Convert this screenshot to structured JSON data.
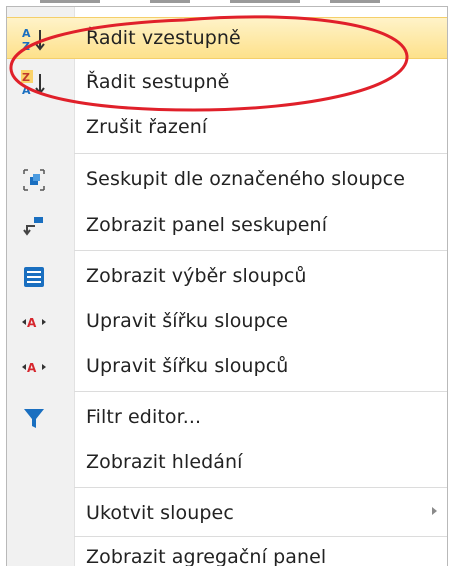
{
  "menu": {
    "items": [
      {
        "label": "Řadit vzestupně",
        "icon": "sort-ascending-icon"
      },
      {
        "label": "Řadit sestupně",
        "icon": "sort-descending-icon"
      },
      {
        "label": "Zrušit řazení",
        "icon": ""
      },
      {
        "label": "Seskupit dle označeného sloupce",
        "icon": "group-by-column-icon"
      },
      {
        "label": "Zobrazit panel seskupení",
        "icon": "group-panel-icon"
      },
      {
        "label": "Zobrazit výběr sloupců",
        "icon": "column-chooser-icon"
      },
      {
        "label": "Upravit šířku sloupce",
        "icon": "best-fit-column-icon"
      },
      {
        "label": "Upravit šířku sloupců",
        "icon": "best-fit-columns-icon"
      },
      {
        "label": "Filtr editor...",
        "icon": "filter-icon"
      },
      {
        "label": "Zobrazit hledání",
        "icon": ""
      },
      {
        "label": "Ukotvit sloupec",
        "icon": "",
        "submenu": true
      },
      {
        "label": "Zobrazit agregační panel",
        "icon": ""
      }
    ]
  },
  "colors": {
    "highlight_top": "#fff3c9",
    "highlight_bottom": "#fde18b",
    "annotation_red": "#e0202a",
    "icon_blue": "#1a6fc0"
  }
}
